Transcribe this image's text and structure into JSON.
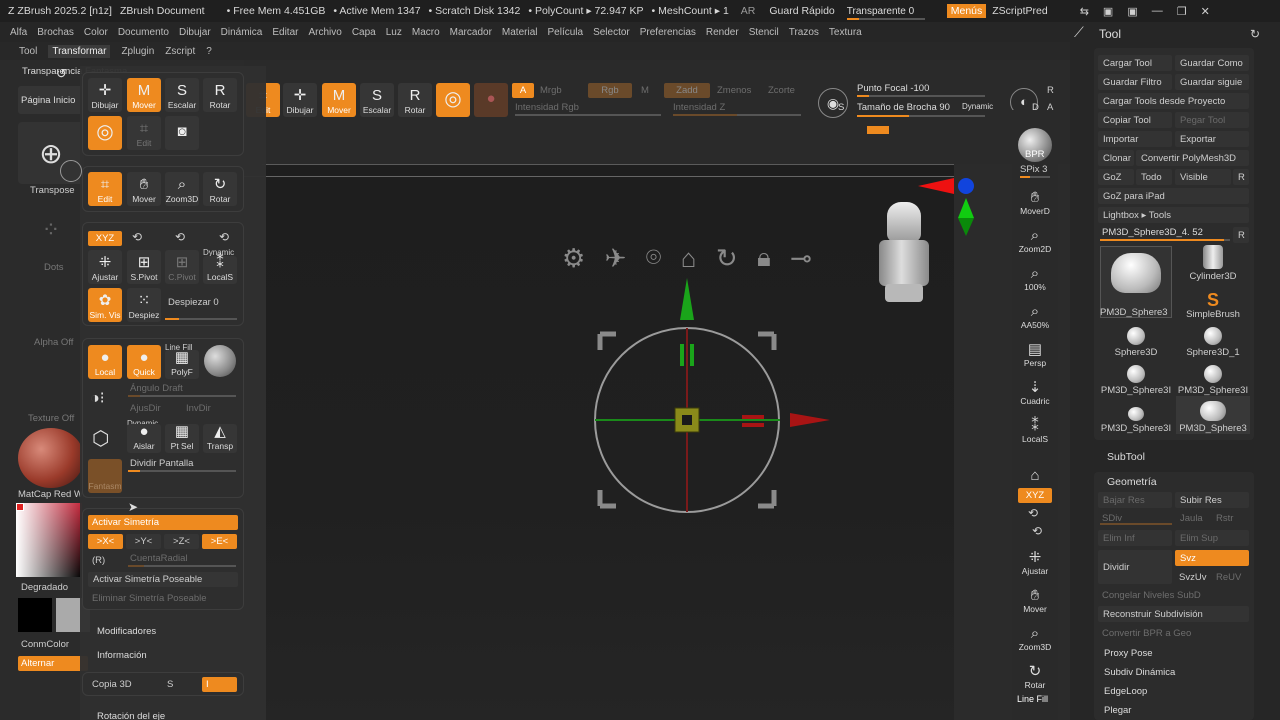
{
  "titlebar": {
    "app": "ZBrush 2025.2 [n1z]",
    "doc": "ZBrush Document",
    "free_mem": "• Free Mem 4.451GB",
    "active_mem": "• Active Mem 1347",
    "scratch": "• Scratch Disk 1342",
    "polycount": "• PolyCount ▸ 72.947 KP",
    "meshcount": "• MeshCount ▸ 1",
    "ar": "AR",
    "guardar": "Guard Rápido",
    "transparente": "Transparente 0",
    "transparente_value": 0.15,
    "menus": "Menús",
    "zscript": "ZScriptPred"
  },
  "menubar": [
    "Alfa",
    "Brochas",
    "Color",
    "Documento",
    "Dibujar",
    "Dinámica",
    "Editar",
    "Archivo",
    "Capa",
    "Luz",
    "Macro",
    "Marcador",
    "Material",
    "Película",
    "Selector",
    "Preferencias",
    "Render",
    "Stencil",
    "Trazos",
    "Textura"
  ],
  "subbar": [
    "Tool",
    "Transformar",
    "Zplugin",
    "Zscript",
    "?"
  ],
  "leftshelf": {
    "transparencia": "Transparencia Fantasma",
    "pagina": "Página Inicio",
    "transpose": "Transpose",
    "dots": "Dots",
    "alpha": "Alpha Off",
    "texture": "Texture Off",
    "matcap": "MatCap Red Wax",
    "degradado": "Degradado",
    "conmcolor": "ConmColor",
    "alternar": "Alternar"
  },
  "toolbar": {
    "edit": "Edit",
    "dibujar": "Dibujar",
    "mover": "Mover",
    "escalar": "Escalar",
    "rotar": "Rotar",
    "a": "A",
    "mrgb": "Mrgb",
    "rgb": "Rgb",
    "m": "M",
    "zadd": "Zadd",
    "zsub": "Zmenos",
    "zcut": "Zcorte",
    "rgb_int": "Intensidad Rgb",
    "z_int": "Intensidad Z",
    "focal": "Punto Focal -100",
    "focal_value": -100,
    "brush_size": "Tamaño de Brocha 90",
    "brush_size_value": 90,
    "dynamic": "Dynamic",
    "s": "S",
    "d": "D",
    "r": "R",
    "a2": "A"
  },
  "palette": {
    "g1": [
      "Dibujar",
      "Mover",
      "Escalar",
      "Rotar"
    ],
    "edit_label": "Edit",
    "g2": [
      "Edit",
      "Mover",
      "Zoom3D",
      "Rotar"
    ],
    "xyz": "XYZ",
    "ajustar": "Ajustar",
    "spivot": "S.Pivot",
    "cpivot": "C.Pivot",
    "dynamic": "Dynamic",
    "locals": "LocalS",
    "simvis": "Sim. Vis",
    "despiez": "Despiez",
    "despiezar": "Despiezar 0",
    "local": "Local",
    "quick": "Quick",
    "linefill": "Line Fill",
    "polyf": "PolyF",
    "angulo": "Ángulo Draft",
    "ajusdir": "AjusDir",
    "invdir": "InvDir",
    "aislar": "Aislar",
    "ptsel": "Pt Sel",
    "transp": "Transp",
    "dividir": "Dividir Pantalla",
    "fantasm": "Fantasm",
    "sim_activar": "Activar Simetría",
    "axes": [
      ">X<",
      ">Y<",
      ">Z<",
      ">E<"
    ],
    "r_label": "(R)",
    "cuenta_radial": "CuentaRadial",
    "poseable": "Activar Simetría Poseable",
    "eliminar": "Eliminar Simetría Poseable",
    "modificadores": "Modificadores",
    "informacion": "Información",
    "copia3d": "Copia 3D",
    "copia_s": "S",
    "copia_i": "I",
    "rotacion": "Rotación del eje"
  },
  "rightstrip": [
    "BPR",
    "SPix 3",
    "MoverD",
    "Zoom2D",
    "100%",
    "AA50%",
    "Persp",
    "Cuadric",
    "LocalS",
    "XYZ",
    "Ajustar",
    "Mover",
    "Zoom3D",
    "Rotar",
    "Line Fill"
  ],
  "rightpanel": {
    "title": "Tool",
    "cargar": "Cargar Tool",
    "guardar": "Guardar Como",
    "guardar_filtro": "Guardar Filtro",
    "guardar_sig": "Guardar siguie",
    "cargar_proy": "Cargar Tools desde Proyecto",
    "copiar": "Copiar Tool",
    "pegar": "Pegar Tool",
    "importar": "Importar",
    "exportar": "Exportar",
    "clonar": "Clonar",
    "convertir": "Convertir PolyMesh3D",
    "goz": "GoZ",
    "todo": "Todo",
    "visible": "Visible",
    "r": "R",
    "goz_ipad": "GoZ para iPad",
    "lightbox": "Lightbox ▸ Tools",
    "current": "PM3D_Sphere3D_4. 52",
    "thumbs": [
      "PM3D_Sphere3",
      "Cylinder3D",
      "SimpleBrush",
      "Sphere3D",
      "Sphere3D_1",
      "PM3D_Sphere3I",
      "PM3D_Sphere3I",
      "PM3D_Sphere3I",
      "PM3D_Sphere3"
    ],
    "subtool": "SubTool",
    "geometria": "Geometría",
    "bajar": "Bajar Res",
    "subir": "Subir Res",
    "sdiv": "SDiv",
    "jaula": "Jaula",
    "rstr": "Rstr",
    "elim_inf": "Elim Inf",
    "elim_sup": "Elim Sup",
    "dividir": "Dividir",
    "svz": "Svz",
    "svzuv": "SvzUv",
    "reuv": "ReUV",
    "congelar": "Congelar Niveles SubD",
    "reconstruir": "Reconstruir Subdivisión",
    "convertir_bpr": "Convertir BPR a Geo",
    "proxy": "Proxy Pose",
    "subdiv": "Subdiv Dinámica",
    "edgeloop": "EdgeLoop",
    "plegar": "Plegar"
  },
  "colors": {
    "accent": "#ee8a1f",
    "panel": "#2e2e2e",
    "background": "#2b2b2b"
  }
}
